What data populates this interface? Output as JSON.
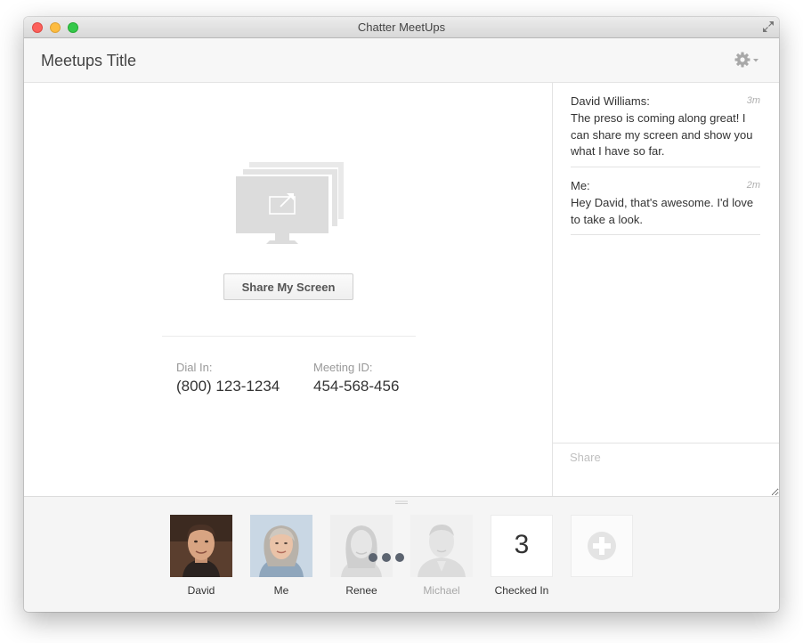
{
  "window": {
    "title": "Chatter MeetUps"
  },
  "header": {
    "title": "Meetups Title"
  },
  "main": {
    "share_button_label": "Share My Screen",
    "dial_in": {
      "label": "Dial In:",
      "value": "(800) 123-1234"
    },
    "meeting_id": {
      "label": "Meeting ID:",
      "value": "454-568-456"
    }
  },
  "chat": {
    "messages": [
      {
        "author": "David Williams:",
        "time": "3m",
        "text": "The preso is coming along great! I can share my screen and show you what I have so far."
      },
      {
        "author": "Me:",
        "time": "2m",
        "text": "Hey David, that's awesome. I'd love to take a look."
      }
    ],
    "input_placeholder": "Share"
  },
  "participants": [
    {
      "name": "David",
      "status": "active"
    },
    {
      "name": "Me",
      "status": "active"
    },
    {
      "name": "Renee",
      "status": "connecting"
    },
    {
      "name": "Michael",
      "status": "inactive"
    }
  ],
  "checked_in": {
    "count": "3",
    "label": "Checked In"
  },
  "colors": {
    "titlebar": "#dedede",
    "header_bg": "#f7f7f7",
    "border": "#e3e3e3",
    "participants_bg": "#f5f5f5",
    "text": "#333333",
    "muted": "#999999"
  }
}
